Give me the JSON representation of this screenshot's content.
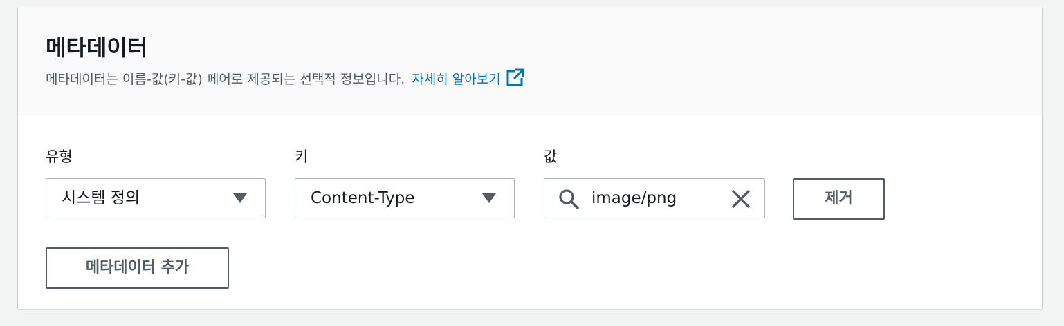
{
  "section": {
    "title": "메타데이터",
    "description": "메타데이터는 이름-값(키-값) 페어로 제공되는 선택적 정보입니다.",
    "learn_more_link": "자세히 알아보기",
    "link_icon": "external-link-icon"
  },
  "metadata_row": {
    "type_label": "유형",
    "type_value": "시스템 정의",
    "key_label": "키",
    "key_value": "Content-Type",
    "value_label": "값",
    "value_input": "image/png",
    "search_icon": "search-icon",
    "clear_icon": "close-icon",
    "remove_button": "제거"
  },
  "add_button": "메타데이터 추가",
  "colors": {
    "link": "#0073bb",
    "text": "#16191f",
    "secondary_text": "#545b64",
    "border": "#aab7b8",
    "header_bg": "#fafafa",
    "page_bg": "#f2f3f3"
  }
}
